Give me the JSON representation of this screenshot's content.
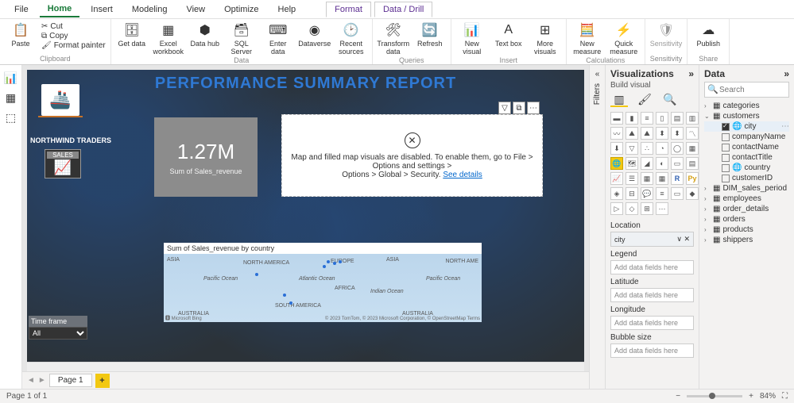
{
  "tabs": {
    "file": "File",
    "home": "Home",
    "insert": "Insert",
    "modeling": "Modeling",
    "view": "View",
    "optimize": "Optimize",
    "help": "Help",
    "format": "Format",
    "datadrill": "Data / Drill"
  },
  "ribbon": {
    "clipboard": {
      "label": "Clipboard",
      "paste": "Paste",
      "cut": "Cut",
      "copy": "Copy",
      "fmtpainter": "Format painter"
    },
    "data": {
      "label": "Data",
      "getdata": "Get data",
      "excel": "Excel workbook",
      "hub": "Data hub",
      "sql": "SQL Server",
      "enter": "Enter data",
      "dataverse": "Dataverse",
      "recent": "Recent sources"
    },
    "queries": {
      "label": "Queries",
      "transform": "Transform data",
      "refresh": "Refresh"
    },
    "insert": {
      "label": "Insert",
      "newvis": "New visual",
      "textbox": "Text box",
      "morevis": "More visuals"
    },
    "calc": {
      "label": "Calculations",
      "newmeas": "New measure",
      "quick": "Quick measure"
    },
    "sens": {
      "label": "Sensitivity",
      "btn": "Sensitivity"
    },
    "share": {
      "label": "Share",
      "publish": "Publish"
    }
  },
  "report": {
    "title": "PERFORMANCE SUMMARY REPORT",
    "brand": "NORTHWIND TRADERS",
    "sales": "SALES",
    "kpi_value": "1.27M",
    "kpi_sub": "Sum of Sales_revenue",
    "map_warning_1": "Map and filled map visuals are disabled. To enable them, go to File > Options and settings >",
    "map_warning_2": "Options > Global > Security. ",
    "map_link": "See details",
    "map2_title": "Sum of Sales_revenue by country",
    "map_labels": {
      "asia1": "ASIA",
      "na": "NORTH AMERICA",
      "eu": "EUROPE",
      "asia2": "ASIA",
      "name": "NORTH AME",
      "pac1": "Pacific Ocean",
      "atl": "Atlantic Ocean",
      "ind": "Indian Ocean",
      "pac2": "Pacific Ocean",
      "af": "AFRICA",
      "sa": "SOUTH AMERICA",
      "aus1": "AUSTRALIA",
      "aus2": "AUSTRALIA"
    },
    "map_attr": "© 2023 TomTom, © 2023 Microsoft Corporation, © OpenStreetMap  Terms",
    "tf_label": "Time frame",
    "tf_value": "All"
  },
  "page": {
    "page1": "Page 1"
  },
  "filters": {
    "title": "Filters"
  },
  "vis": {
    "title": "Visualizations",
    "sub": "Build visual",
    "fields": {
      "location": "Location",
      "location_val": "city",
      "legend": "Legend",
      "latitude": "Latitude",
      "longitude": "Longitude",
      "bubble": "Bubble size",
      "placeholder": "Add data fields here"
    }
  },
  "data": {
    "title": "Data",
    "search_ph": "Search",
    "tables": {
      "categories": "categories",
      "customers": "customers",
      "city": "city",
      "companyName": "companyName",
      "contactName": "contactName",
      "contactTitle": "contactTitle",
      "country": "country",
      "customerID": "customerID",
      "dim": "DIM_sales_period",
      "employees": "employees",
      "order_details": "order_details",
      "orders": "orders",
      "products": "products",
      "shippers": "shippers"
    }
  },
  "status": {
    "pg": "Page 1 of 1",
    "zoom": "84%"
  }
}
